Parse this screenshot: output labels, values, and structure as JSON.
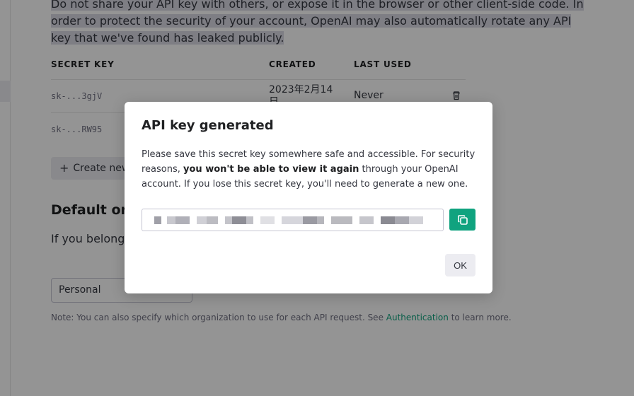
{
  "page": {
    "warning_text": "Do not share your API key with others, or expose it in the browser or other client-side code. In order to protect the security of your account, OpenAI may also automatically rotate any API key that we've found has leaked publicly."
  },
  "keys_table": {
    "headers": {
      "secret_key": "SECRET KEY",
      "created": "CREATED",
      "last_used": "LAST USED"
    },
    "rows": [
      {
        "key": "sk-...3gjV",
        "created": "2023年2月14日",
        "last_used": "Never",
        "delete_icon": "trash-icon"
      },
      {
        "key": "sk-...RW95",
        "created": "",
        "last_used": "",
        "delete_icon": ""
      }
    ],
    "create_button": {
      "icon": "plus-icon",
      "label": "Create new"
    }
  },
  "default_org": {
    "title": "Default org",
    "description": "If you belong t                                                                                               ed by default when making r",
    "select_value": "Personal",
    "note_prefix": "Note: You can also specify which organization to use for each API request. See",
    "note_link": "Authentication",
    "note_suffix": " to learn more."
  },
  "modal": {
    "title": "API key generated",
    "body_prefix": "Please save this secret key somewhere safe and accessible. For security reasons, ",
    "body_bold": "you won't be able to view it again",
    "body_suffix": " through your OpenAI account. If you lose this secret key, you'll need to generate a new one.",
    "copy_icon": "copy-icon",
    "ok_label": "OK"
  },
  "colors": {
    "accent": "#10a37f",
    "overlay": "rgba(0,0,0,0.42)"
  }
}
